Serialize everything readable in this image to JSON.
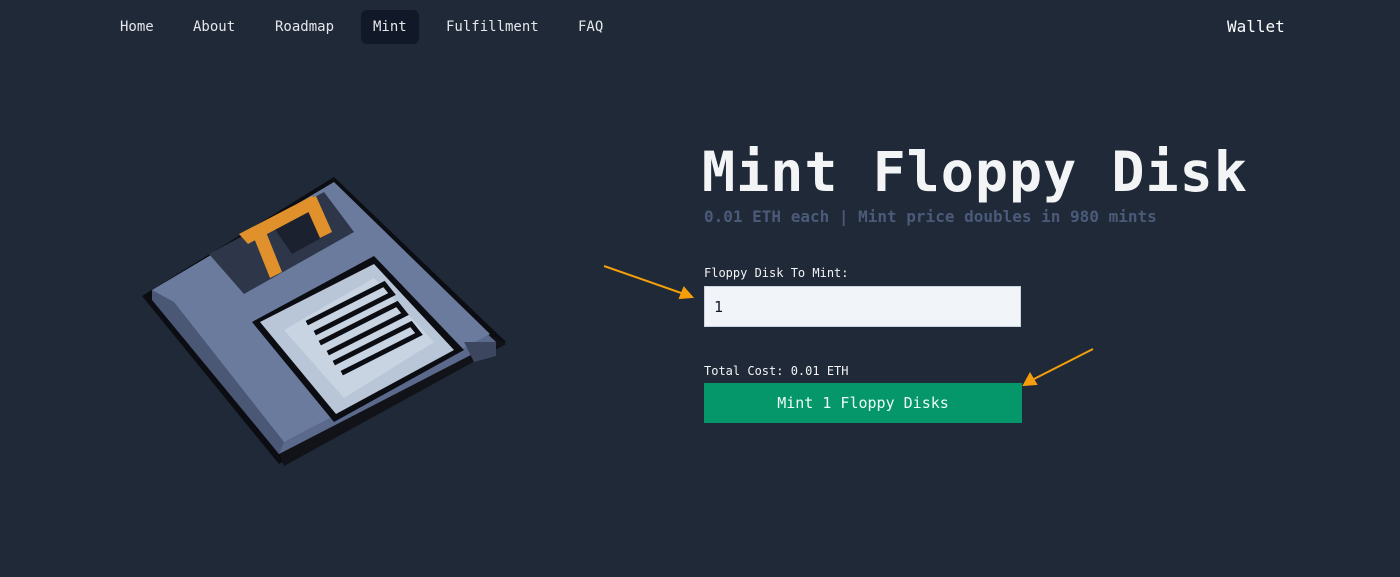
{
  "nav": {
    "items": [
      {
        "label": "Home"
      },
      {
        "label": "About"
      },
      {
        "label": "Roadmap"
      },
      {
        "label": "Mint",
        "active": true
      },
      {
        "label": "Fulfillment"
      },
      {
        "label": "FAQ"
      }
    ],
    "wallet_label": "Wallet"
  },
  "hero": {
    "title": "Mint Floppy Disk",
    "subtitle": "0.01 ETH each | Mint price doubles in 980 mints",
    "image_icon": "floppy-disk-pixel-art"
  },
  "mint_form": {
    "quantity_label": "Floppy Disk To Mint:",
    "quantity_value": "1",
    "total_cost_text": "Total Cost: 0.01 ETH",
    "button_label": "Mint 1 Floppy Disks"
  },
  "colors": {
    "background": "#1f2937",
    "nav_active": "#111827",
    "subtitle": "#4b5a78",
    "button": "#059669",
    "annotation_arrow": "#f59e0b",
    "disk_body": "#5b6a8c",
    "disk_label": "#b9c6d8",
    "disk_shutter": "#e0912b"
  }
}
